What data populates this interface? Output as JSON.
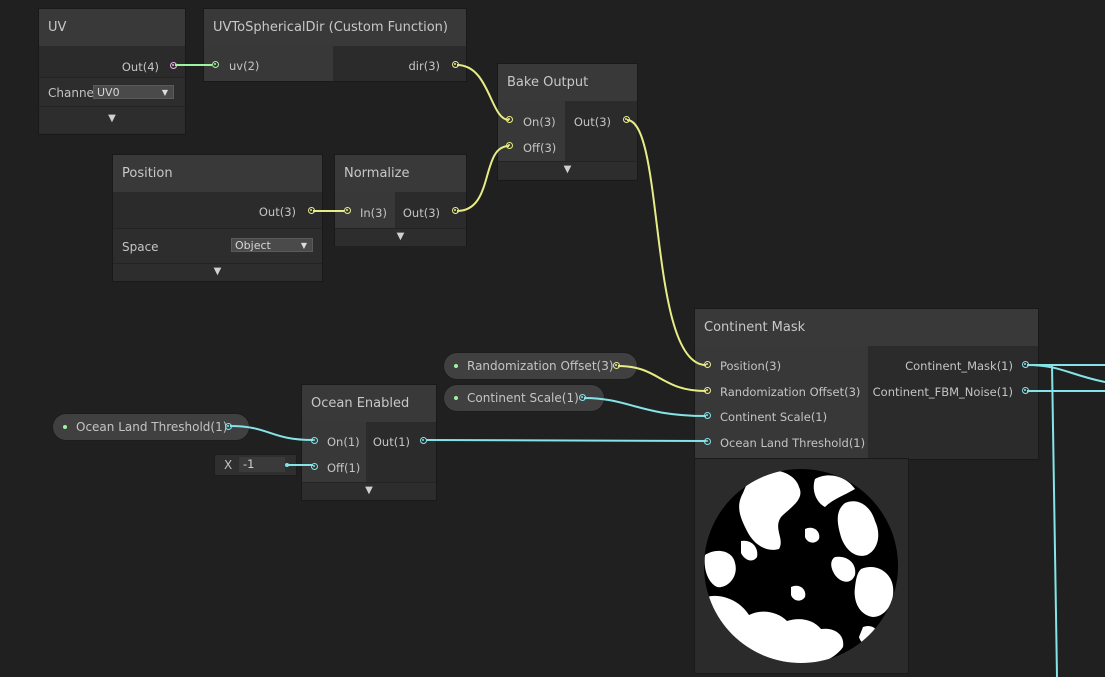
{
  "nodes": {
    "uv": {
      "title": "UV",
      "out": "Out(4)",
      "channel_label": "Channe",
      "channel_value": "UV0"
    },
    "uvsph": {
      "title": "UVToSphericalDir (Custom Function)",
      "in": "uv(2)",
      "out": "dir(3)"
    },
    "bake": {
      "title": "Bake Output",
      "in_on": "On(3)",
      "in_off": "Off(3)",
      "out": "Out(3)"
    },
    "position": {
      "title": "Position",
      "out": "Out(3)",
      "space_label": "Space",
      "space_value": "Object"
    },
    "normalize": {
      "title": "Normalize",
      "in": "In(3)",
      "out": "Out(3)"
    },
    "ocean": {
      "title": "Ocean Enabled",
      "in_on": "On(1)",
      "in_off": "Off(1)",
      "out": "Out(1)"
    },
    "continent": {
      "title": "Continent Mask",
      "inputs": [
        "Position(3)",
        "Randomization Offset(3)",
        "Continent Scale(1)",
        "Ocean Land Threshold(1)"
      ],
      "outputs": [
        "Continent_Mask(1)",
        "Continent_FBM_Noise(1)"
      ]
    }
  },
  "properties": {
    "randomization_offset": "Randomization Offset(3)",
    "continent_scale": "Continent Scale(1)",
    "ocean_land_threshold": "Ocean Land Threshold(1)"
  },
  "constant": {
    "label": "X",
    "value": "-1"
  },
  "colors": {
    "vector3": "#e8ec86",
    "vector1": "#84e4e7",
    "vector2": "#9ff29f",
    "vector4": "#f0b0e8",
    "canvas": "#202020"
  },
  "icons": {
    "collapse": "chevron-down-icon",
    "dropdown": "dropdown-arrow-icon"
  }
}
